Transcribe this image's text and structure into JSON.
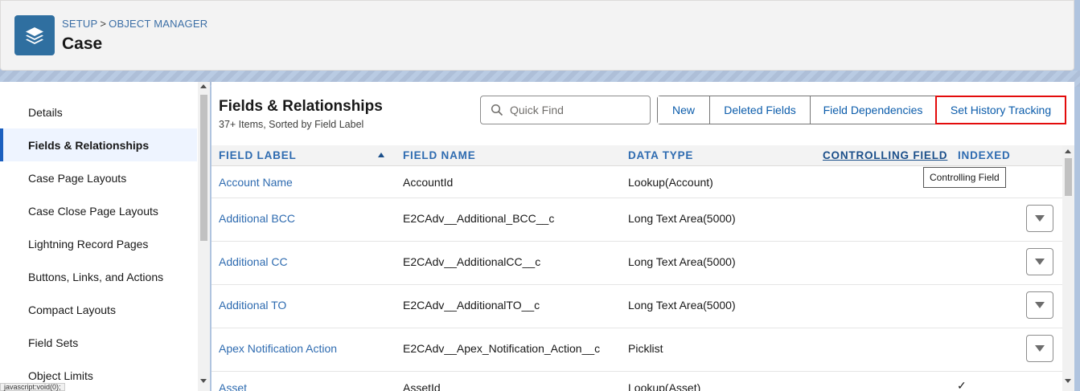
{
  "header": {
    "breadcrumb_setup": "SETUP",
    "breadcrumb_sep": ">",
    "breadcrumb_object_manager": "OBJECT MANAGER",
    "title": "Case",
    "icon": "layers-icon"
  },
  "sidebar": {
    "items": [
      {
        "label": "Details"
      },
      {
        "label": "Fields & Relationships",
        "active": true
      },
      {
        "label": "Case Page Layouts"
      },
      {
        "label": "Case Close Page Layouts"
      },
      {
        "label": "Lightning Record Pages"
      },
      {
        "label": "Buttons, Links, and Actions"
      },
      {
        "label": "Compact Layouts"
      },
      {
        "label": "Field Sets"
      },
      {
        "label": "Object Limits"
      }
    ],
    "status_tip": "javascript:void(0);"
  },
  "main": {
    "title": "Fields & Relationships",
    "subtitle": "37+ Items, Sorted by Field Label",
    "search_placeholder": "Quick Find",
    "buttons": {
      "new": "New",
      "deleted_fields": "Deleted Fields",
      "field_dependencies": "Field Dependencies",
      "set_history_tracking": "Set History Tracking"
    },
    "columns": {
      "field_label": "FIELD LABEL",
      "field_name": "FIELD NAME",
      "data_type": "DATA TYPE",
      "controlling_field": "CONTROLLING FIELD",
      "indexed": "INDEXED"
    },
    "tooltip": "Controlling Field",
    "rows": [
      {
        "label": "Account Name",
        "name": "AccountId",
        "type": "Lookup(Account)",
        "menu": false
      },
      {
        "label": "Additional BCC",
        "name": "E2CAdv__Additional_BCC__c",
        "type": "Long Text Area(5000)",
        "menu": true
      },
      {
        "label": "Additional CC",
        "name": "E2CAdv__AdditionalCC__c",
        "type": "Long Text Area(5000)",
        "menu": true
      },
      {
        "label": "Additional TO",
        "name": "E2CAdv__AdditionalTO__c",
        "type": "Long Text Area(5000)",
        "menu": true
      },
      {
        "label": "Apex Notification Action",
        "name": "E2CAdv__Apex_Notification_Action__c",
        "type": "Picklist",
        "menu": true
      },
      {
        "label": "Asset",
        "name": "AssetId",
        "type": "Lookup(Asset)",
        "menu": false,
        "indexed": "✓"
      }
    ]
  },
  "colors": {
    "accent": "#0b5cab",
    "highlight": "#e30b0b",
    "app_icon": "#2f6fa0"
  }
}
